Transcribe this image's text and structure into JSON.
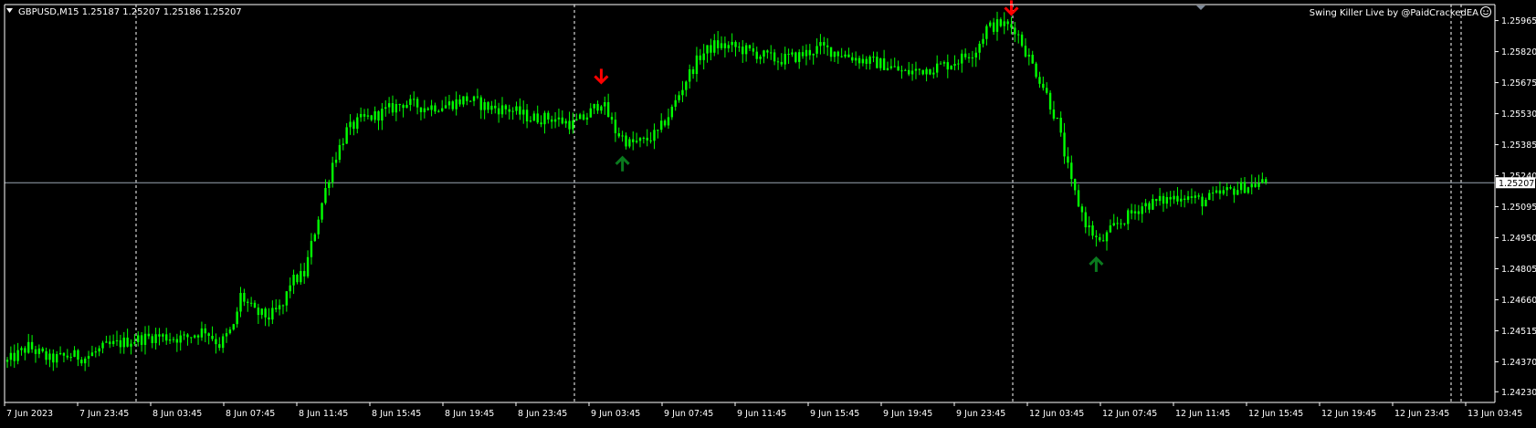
{
  "header": {
    "symbol_info": "GBPUSD,M15  1.25187 1.25207 1.25186 1.25207",
    "indicator_label": "Swing Killer Live by @PaidCrackedEA"
  },
  "colors": {
    "background": "#000000",
    "candle": "#00FF00",
    "grid": "#FFFFFF",
    "axis": "#FFFFFF",
    "price_line": "#9AA6B2",
    "sell_arrow": "#FF0000",
    "buy_arrow": "#0A7A1E",
    "text": "#FFFFFF"
  },
  "icons": {
    "dropdown": "triangle-down-icon",
    "smiley": "smiley-face-icon",
    "scroll_marker": "triangle-down-icon",
    "sell_signal": "arrow-down-icon",
    "buy_signal": "arrow-up-icon"
  },
  "chart_data": {
    "type": "candlestick",
    "symbol": "GBPUSD",
    "timeframe": "M15",
    "ylim": [
      1.2418,
      1.2604
    ],
    "y_ticks": [
      "1.25965",
      "1.25820",
      "1.25675",
      "1.25530",
      "1.25385",
      "1.25240",
      "1.25095",
      "1.24950",
      "1.24805",
      "1.24660",
      "1.24515",
      "1.24370",
      "1.24230"
    ],
    "current_price": "1.25207",
    "x_labels": [
      "7 Jun 2023",
      "7 Jun 23:45",
      "8 Jun 03:45",
      "8 Jun 07:45",
      "8 Jun 11:45",
      "8 Jun 15:45",
      "8 Jun 19:45",
      "8 Jun 23:45",
      "9 Jun 03:45",
      "9 Jun 07:45",
      "9 Jun 11:45",
      "9 Jun 15:45",
      "9 Jun 19:45",
      "9 Jun 23:45",
      "12 Jun 03:45",
      "12 Jun 07:45",
      "12 Jun 11:45",
      "12 Jun 15:45",
      "12 Jun 19:45",
      "12 Jun 23:45",
      "13 Jun 03:45"
    ],
    "day_separators": [
      "7 Jun 23:45",
      "8 Jun 23:45",
      "9 Jun 23:45",
      "12 Jun 23:45"
    ],
    "grid": "day separators only",
    "price_path": [
      [
        0,
        1.2437
      ],
      [
        6,
        1.2444
      ],
      [
        12,
        1.2438
      ],
      [
        18,
        1.244
      ],
      [
        22,
        1.2439
      ],
      [
        28,
        1.2444
      ],
      [
        35,
        1.2447
      ],
      [
        42,
        1.2449
      ],
      [
        50,
        1.2448
      ],
      [
        56,
        1.2452
      ],
      [
        60,
        1.2445
      ],
      [
        64,
        1.2453
      ],
      [
        66,
        1.2468
      ],
      [
        70,
        1.246
      ],
      [
        74,
        1.2458
      ],
      [
        78,
        1.2463
      ],
      [
        80,
        1.2474
      ],
      [
        84,
        1.2478
      ],
      [
        88,
        1.2505
      ],
      [
        92,
        1.253
      ],
      [
        96,
        1.2545
      ],
      [
        100,
        1.255
      ],
      [
        104,
        1.2552
      ],
      [
        108,
        1.2555
      ],
      [
        112,
        1.2558
      ],
      [
        118,
        1.2556
      ],
      [
        124,
        1.2557
      ],
      [
        130,
        1.256
      ],
      [
        136,
        1.2556
      ],
      [
        142,
        1.2555
      ],
      [
        148,
        1.2551
      ],
      [
        154,
        1.2551
      ],
      [
        160,
        1.2548
      ],
      [
        164,
        1.2552
      ],
      [
        168,
        1.2559
      ],
      [
        172,
        1.2545
      ],
      [
        176,
        1.2539
      ],
      [
        180,
        1.254
      ],
      [
        184,
        1.2544
      ],
      [
        188,
        1.2555
      ],
      [
        192,
        1.2569
      ],
      [
        196,
        1.258
      ],
      [
        200,
        1.2585
      ],
      [
        206,
        1.2584
      ],
      [
        212,
        1.2581
      ],
      [
        218,
        1.2578
      ],
      [
        224,
        1.258
      ],
      [
        230,
        1.2584
      ],
      [
        236,
        1.2581
      ],
      [
        242,
        1.2578
      ],
      [
        248,
        1.2576
      ],
      [
        254,
        1.2572
      ],
      [
        260,
        1.2574
      ],
      [
        266,
        1.2576
      ],
      [
        270,
        1.2579
      ],
      [
        274,
        1.2583
      ],
      [
        277,
        1.2593
      ],
      [
        281,
        1.2595
      ],
      [
        285,
        1.2593
      ],
      [
        289,
        1.2579
      ],
      [
        293,
        1.2566
      ],
      [
        297,
        1.2549
      ],
      [
        301,
        1.252
      ],
      [
        305,
        1.2502
      ],
      [
        309,
        1.2492
      ],
      [
        313,
        1.25
      ],
      [
        317,
        1.2505
      ],
      [
        321,
        1.251
      ],
      [
        326,
        1.2512
      ],
      [
        332,
        1.2515
      ],
      [
        338,
        1.2512
      ],
      [
        344,
        1.2516
      ],
      [
        350,
        1.2519
      ],
      [
        356,
        1.2521
      ]
    ],
    "signals": [
      {
        "type": "sell",
        "bar": 168,
        "price": 1.2568
      },
      {
        "type": "buy",
        "bar": 174,
        "price": 1.2532
      },
      {
        "type": "sell",
        "bar": 284,
        "price": 1.26
      },
      {
        "type": "buy",
        "bar": 308,
        "price": 1.2485
      }
    ]
  }
}
